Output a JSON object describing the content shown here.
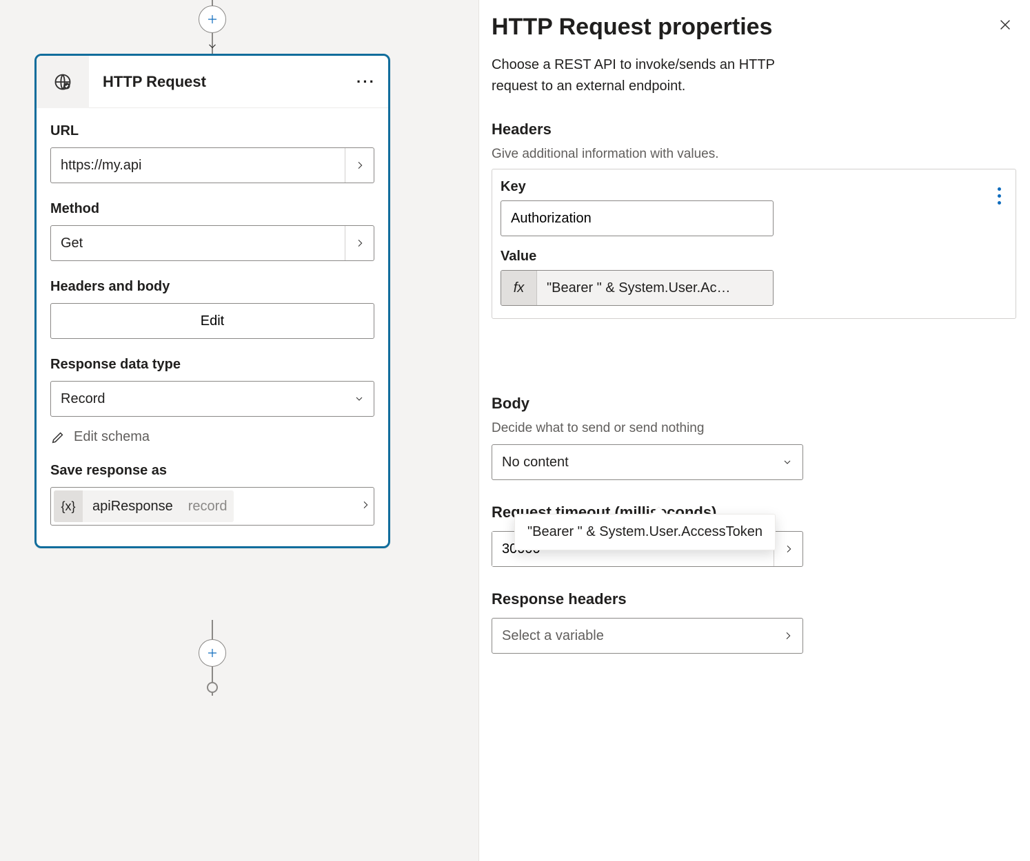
{
  "node": {
    "title": "HTTP Request",
    "fields": {
      "url_label": "URL",
      "url_value": "https://my.api",
      "method_label": "Method",
      "method_value": "Get",
      "headers_body_label": "Headers and body",
      "edit_button": "Edit",
      "response_type_label": "Response data type",
      "response_type_value": "Record",
      "edit_schema": "Edit schema",
      "save_as_label": "Save response as",
      "variable_name": "apiResponse",
      "variable_type": "record"
    }
  },
  "panel": {
    "title": "HTTP Request properties",
    "description": "Choose a REST API to invoke/sends an HTTP request to an external endpoint.",
    "headers": {
      "title": "Headers",
      "subtitle": "Give additional information with values.",
      "key_label": "Key",
      "key_value": "Authorization",
      "value_label": "Value",
      "fx_label": "fx",
      "value_expr_truncated": "\"Bearer \" & System.User.Ac…",
      "value_expr_full": "\"Bearer \" & System.User.AccessToken"
    },
    "body": {
      "title": "Body",
      "subtitle": "Decide what to send or send nothing",
      "value": "No content"
    },
    "timeout": {
      "title": "Request timeout (milliseconds)",
      "value": "30000"
    },
    "response_headers": {
      "title": "Response headers",
      "placeholder": "Select a variable"
    }
  },
  "icons": {
    "variable_braces": "{x}"
  }
}
